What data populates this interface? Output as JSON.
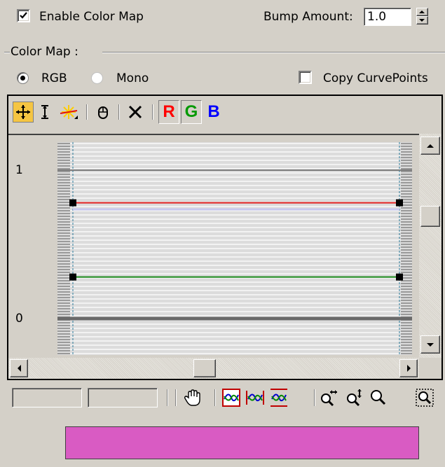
{
  "top": {
    "enable_color_map_label": "Enable Color Map",
    "enable_color_map_checked": true,
    "bump_amount_label": "Bump Amount:",
    "bump_amount_value": "1.0"
  },
  "color_map": {
    "group_label": "Color Map :",
    "rgb_label": "RGB",
    "mono_label": "Mono",
    "selected_mode": "RGB",
    "copy_curvepoints_label": "Copy CurvePoints",
    "copy_curvepoints_checked": false
  },
  "toolbar": {
    "icons": [
      "move-icon",
      "scale-point-icon",
      "insert-point-icon",
      "reset-icon",
      "delete-point-icon"
    ],
    "channel_r_label": "R",
    "channel_g_label": "G",
    "channel_b_label": "B",
    "colors": {
      "r": "#ff0000",
      "g": "#009900",
      "b": "#0000ff",
      "accent": "#f5c542"
    }
  },
  "graph": {
    "y_label_top": "1",
    "y_label_bottom": "0",
    "curves": [
      {
        "name": "red-curve",
        "value": 0.78,
        "color": "#e02020"
      },
      {
        "name": "green-curve",
        "value": 0.28,
        "color": "#1a8a1a"
      }
    ]
  },
  "bottom_toolbar": {
    "point_field_1": "",
    "point_field_2": "",
    "icons": [
      "pan-icon",
      "zoom-extents-icon",
      "zoom-horizontal-extents-icon",
      "zoom-value-extents-icon",
      "zoom-horizontal-icon",
      "zoom-vertical-icon",
      "zoom-icon",
      "zoom-region-icon"
    ]
  },
  "preview": {
    "color": "#d95bc3"
  }
}
